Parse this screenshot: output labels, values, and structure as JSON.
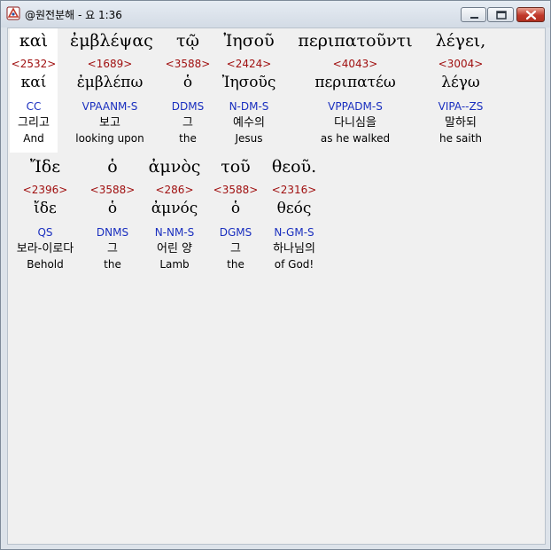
{
  "window": {
    "title": "@원전분해 - 요 1:36",
    "buttons": [
      "minimize-icon",
      "maximize-icon",
      "close-icon"
    ],
    "colors": {
      "strong": "#a01010",
      "parse": "#1a2fbf",
      "selected_bg": "#ffffff"
    }
  },
  "lines": [
    {
      "words": [
        {
          "greek": "καὶ",
          "strong": "<2532>",
          "lemma": "καί",
          "parse": "CC",
          "korean": "그리고",
          "english": "And",
          "selected": true
        },
        {
          "greek": "ἐμβλέψας",
          "strong": "<1689>",
          "lemma": "ἐμβλέπω",
          "parse": "VPAANM-S",
          "korean": "보고",
          "english": "looking upon"
        },
        {
          "greek": "τῷ",
          "strong": "<3588>",
          "lemma": "ὁ",
          "parse": "DDMS",
          "korean": "그",
          "english": "the"
        },
        {
          "greek": "Ἰησοῦ",
          "strong": "<2424>",
          "lemma": "Ἰησοῦς",
          "parse": "N-DM-S",
          "korean": "예수의",
          "english": "Jesus"
        },
        {
          "greek": "περιπατοῦντι",
          "strong": "<4043>",
          "lemma": "περιπατέω",
          "parse": "VPPADM-S",
          "korean": "다니심을",
          "english": "as he walked"
        },
        {
          "greek": "λέγει,",
          "strong": "<3004>",
          "lemma": "λέγω",
          "parse": "VIPA--ZS",
          "korean": "말하되",
          "english": "he saith"
        }
      ]
    },
    {
      "words": [
        {
          "greek": "Ἴδε",
          "strong": "<2396>",
          "lemma": "ἴδε",
          "parse": "QS",
          "korean": "보라-이로다",
          "english": "Behold"
        },
        {
          "greek": "ὁ",
          "strong": "<3588>",
          "lemma": "ὁ",
          "parse": "DNMS",
          "korean": "그",
          "english": "the"
        },
        {
          "greek": "ἀμνὸς",
          "strong": "<286>",
          "lemma": "ἀμνός",
          "parse": "N-NM-S",
          "korean": "어린 양",
          "english": "Lamb"
        },
        {
          "greek": "τοῦ",
          "strong": "<3588>",
          "lemma": "ὁ",
          "parse": "DGMS",
          "korean": "그",
          "english": "the"
        },
        {
          "greek": "θεοῦ.",
          "strong": "<2316>",
          "lemma": "θεός",
          "parse": "N-GM-S",
          "korean": "하나님의",
          "english": "of God!"
        }
      ]
    }
  ]
}
